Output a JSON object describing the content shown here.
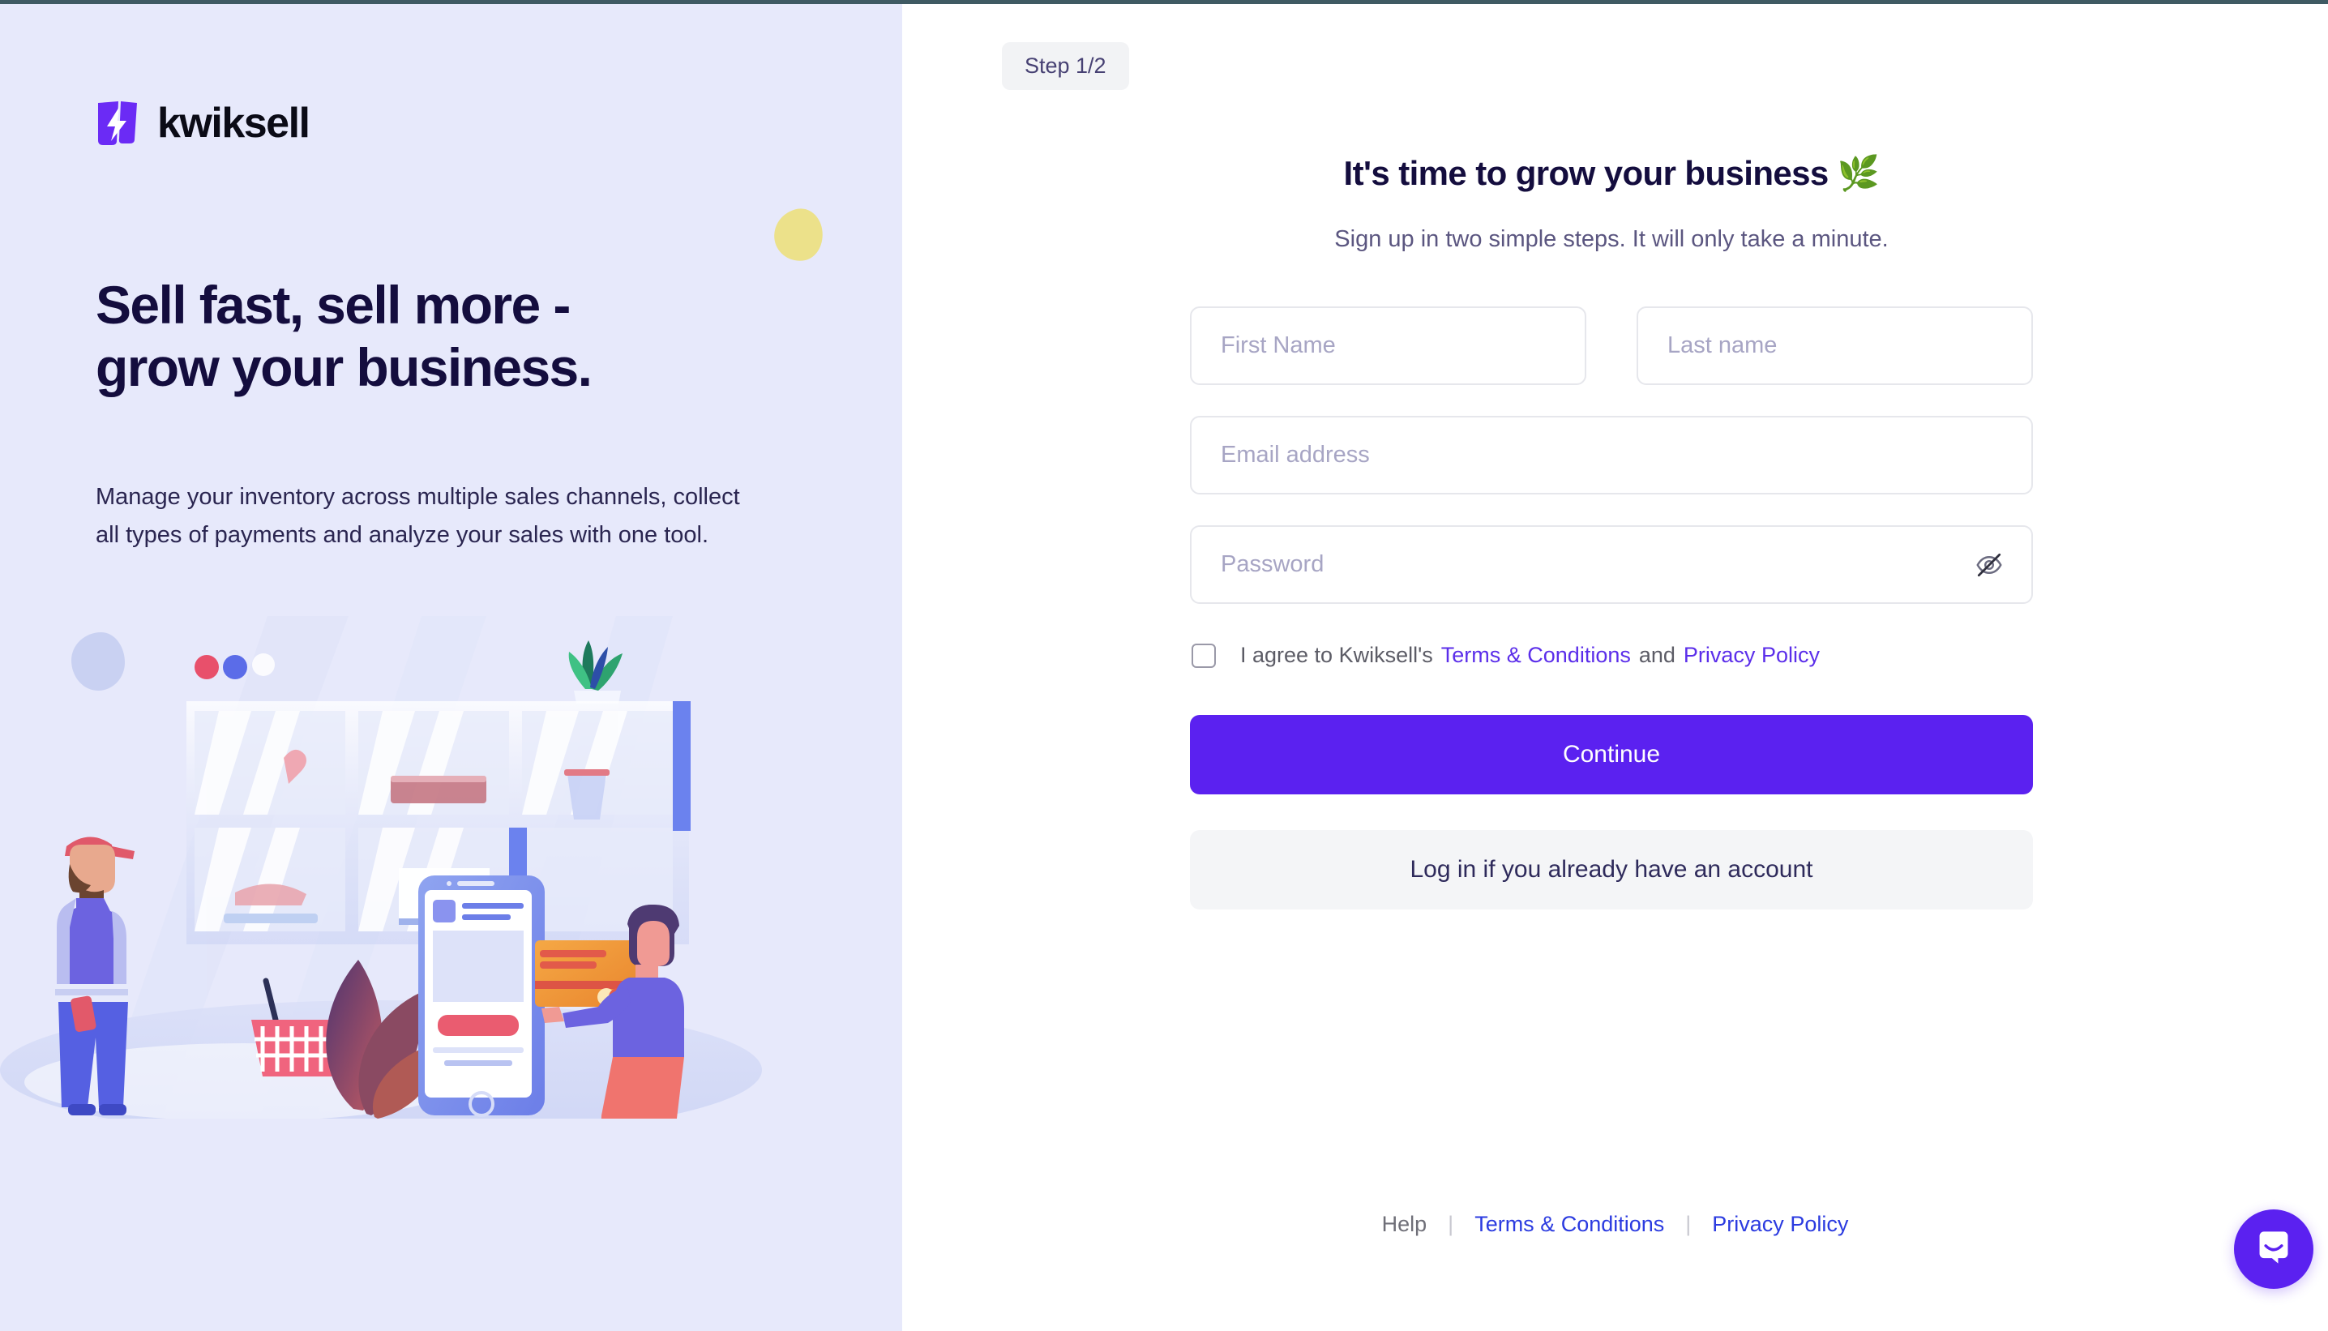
{
  "brand": {
    "name": "kwiksell",
    "logo_color": "#5B21F0",
    "icon": "lightning-bolt-icon"
  },
  "left_panel": {
    "background": "#E7E9FB",
    "headline": "Sell fast, sell more - grow your business.",
    "headline_line1": "Sell fast, sell more -",
    "headline_line2": "grow your business.",
    "subtext": "Manage your inventory across multiple sales channels, collect all types of payments and analyze your sales with one tool.",
    "illustration_alt": "ecommerce-illustration"
  },
  "step_badge": {
    "label": "Step 1/2",
    "background": "#F2F3F5",
    "text_color": "#474173"
  },
  "form": {
    "title": "It's time to grow your business 🌿",
    "subtitle": "Sign up in two simple steps. It will only take a minute.",
    "fields": {
      "first_name": {
        "placeholder": "First Name",
        "value": ""
      },
      "last_name": {
        "placeholder": "Last name",
        "value": ""
      },
      "email": {
        "placeholder": "Email address",
        "value": ""
      },
      "password": {
        "placeholder": "Password",
        "value": "",
        "visibility_icon": "eye-slash-icon"
      }
    },
    "terms": {
      "prefix": "I agree to Kwiksell's",
      "terms_link": "Terms & Conditions",
      "conjunction": "and",
      "privacy_link": "Privacy Policy",
      "checked": false,
      "link_color": "#5B2EEA"
    },
    "primary_button": {
      "label": "Continue",
      "background": "#5B21F0",
      "text_color": "#FFFFFF"
    },
    "secondary_button": {
      "label": "Log in if you already have an account",
      "background": "#F4F5F7",
      "text_color": "#2E2A5B"
    }
  },
  "footer": {
    "help": "Help",
    "separator": "|",
    "terms": "Terms & Conditions",
    "privacy": "Privacy Policy",
    "link_color": "#2B3BE0"
  },
  "chat_widget": {
    "name": "intercom-launcher",
    "icon": "chat-bubble-smile-icon",
    "background": "#5B21F0"
  }
}
